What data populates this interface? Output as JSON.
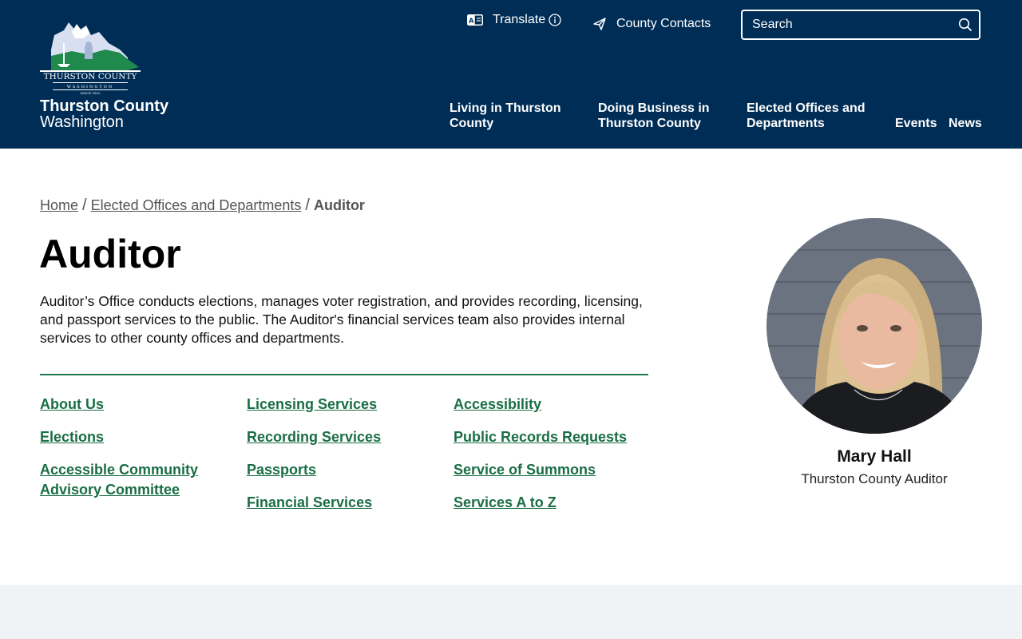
{
  "header": {
    "logo": {
      "text": "THURSTON COUNTY",
      "sub": "WASHINGTON",
      "since": "SINCE 1852"
    },
    "site_name": "Thurston County",
    "site_sub": "Washington",
    "translate_label": "Translate",
    "contacts_label": "County Contacts",
    "search_placeholder": "Search",
    "nav": [
      {
        "line1": "Living in Thurston",
        "line2": "County"
      },
      {
        "line1": "Doing Business in",
        "line2": "Thurston County"
      },
      {
        "line1": "Elected Offices and",
        "line2": "Departments"
      },
      {
        "line1": "Events"
      },
      {
        "line1": "News"
      }
    ]
  },
  "breadcrumb": {
    "home": "Home",
    "parent": "Elected Offices and Departments",
    "current": "Auditor",
    "separator": "/"
  },
  "page": {
    "title": "Auditor",
    "intro": "Auditor’s Office conducts elections, manages voter registration, and provides recording, licensing, and passport services to the public. The Auditor's financial services team also provides internal services to other county offices and departments."
  },
  "links": {
    "col1": [
      "About Us",
      "Elections",
      "Accessible Community Advisory Committee"
    ],
    "col2": [
      "Licensing Services",
      "Recording Services",
      "Passports",
      "Financial Services"
    ],
    "col3": [
      "Accessibility",
      "Public Records Requests",
      "Service of Summons",
      "Services A to Z"
    ]
  },
  "profile": {
    "name": "Mary Hall",
    "title": "Thurston County Auditor"
  },
  "colors": {
    "header_bg": "#002d56",
    "link_green": "#1a6e45",
    "footer_band": "#f0f3f6"
  },
  "icons": [
    "translate-icon",
    "info-icon",
    "send-icon",
    "search-icon"
  ]
}
